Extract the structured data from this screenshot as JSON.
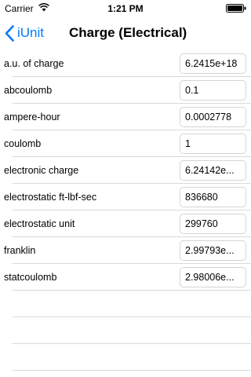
{
  "status_bar": {
    "carrier": "Carrier",
    "time": "1:21 PM"
  },
  "nav": {
    "back_label": "iUnit",
    "title": "Charge (Electrical)"
  },
  "units": [
    {
      "label": "a.u. of charge",
      "value": "6.2415e+18"
    },
    {
      "label": "abcoulomb",
      "value": "0.1"
    },
    {
      "label": "ampere-hour",
      "value": "0.0002778"
    },
    {
      "label": "coulomb",
      "value": "1"
    },
    {
      "label": "electronic charge",
      "value": "6.24142e..."
    },
    {
      "label": "electrostatic ft-lbf-sec",
      "value": "836680"
    },
    {
      "label": "electrostatic unit",
      "value": "299760"
    },
    {
      "label": "franklin",
      "value": "2.99793e..."
    },
    {
      "label": "statcoulomb",
      "value": "2.98006e..."
    }
  ],
  "icons": {
    "wifi": "wifi-icon",
    "battery": "battery-icon",
    "back": "chevron-left-icon"
  },
  "colors": {
    "accent": "#007aff",
    "separator": "#d9d9d9"
  }
}
